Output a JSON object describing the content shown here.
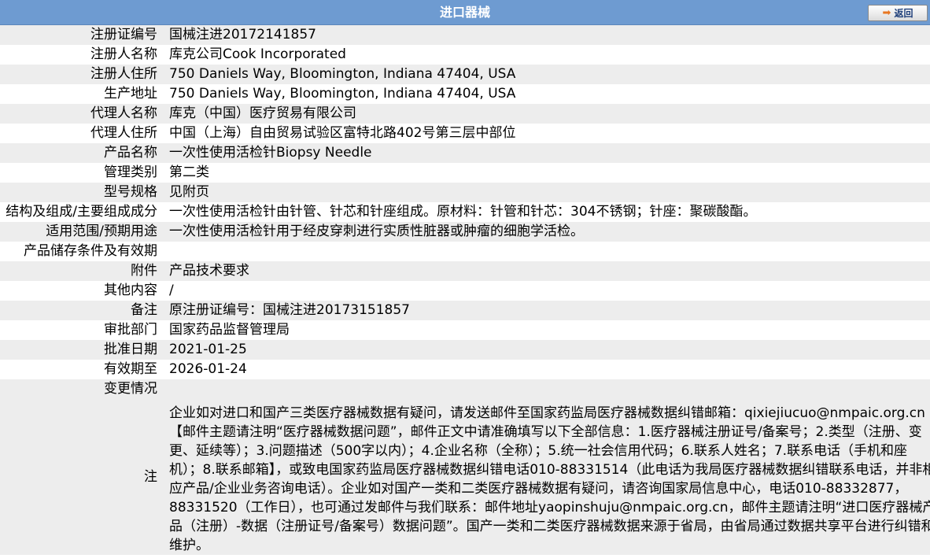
{
  "header": {
    "title": "进口器械",
    "back_label": "返回"
  },
  "rows": [
    {
      "label": "注册证编号",
      "value": "国械注进20172141857"
    },
    {
      "label": "注册人名称",
      "value": "库克公司Cook Incorporated"
    },
    {
      "label": "注册人住所",
      "value": "750 Daniels Way, Bloomington, Indiana 47404, USA"
    },
    {
      "label": "生产地址",
      "value": "750 Daniels Way, Bloomington, Indiana 47404, USA"
    },
    {
      "label": "代理人名称",
      "value": "库克（中国）医疗贸易有限公司"
    },
    {
      "label": "代理人住所",
      "value": "中国（上海）自由贸易试验区富特北路402号第三层中部位"
    },
    {
      "label": "产品名称",
      "value": "一次性使用活检针Biopsy Needle"
    },
    {
      "label": "管理类别",
      "value": "第二类"
    },
    {
      "label": "型号规格",
      "value": "见附页"
    },
    {
      "label": "结构及组成/主要组成成分",
      "value": "一次性使用活检针由针管、针芯和针座组成。原材料：针管和针芯：304不锈钢；针座：聚碳酸酯。"
    },
    {
      "label": "适用范围/预期用途",
      "value": "一次性使用活检针用于经皮穿刺进行实质性脏器或肿瘤的细胞学活检。"
    },
    {
      "label": "产品储存条件及有效期",
      "value": ""
    },
    {
      "label": "附件",
      "value": "产品技术要求"
    },
    {
      "label": "其他内容",
      "value": "/"
    },
    {
      "label": "备注",
      "value": "原注册证编号：国械注进20173151857"
    },
    {
      "label": "审批部门",
      "value": "国家药品监督管理局"
    },
    {
      "label": "批准日期",
      "value": "2021-01-25"
    },
    {
      "label": "有效期至",
      "value": "2026-01-24"
    },
    {
      "label": "变更情况",
      "value": ""
    }
  ],
  "note": {
    "label": "注",
    "text": "企业如对进口和国产三类医疗器械数据有疑问，请发送邮件至国家药监局医疗器械数据纠错邮箱：qixiejiucuo@nmpaic.org.cn【邮件主题请注明“医疗器械数据问题”，邮件正文中请准确填写以下全部信息：1.医疗器械注册证号/备案号；2.类型（注册、变更、延续等）；3.问题描述（500字以内）；4.企业名称（全称）；5.统一社会信用代码；6.联系人姓名；7.联系电话（手机和座机）；8.联系邮箱】，或致电国家药监局医疗器械数据纠错电话010-88331514（此电话为我局医疗器械数据纠错联系电话，并非相应产品/企业业务咨询电话）。企业如对国产一类和二类医疗器械数据有疑问，请咨询国家局信息中心，电话010-88332877，88331520（工作日），也可通过发邮件与我们联系：邮件地址yaopinshuju@nmpaic.org.cn，邮件主题请注明“进口医疗器械产品（注册）-数据（注册证号/备案号）数据问题”。国产一类和二类医疗器械数据来源于省局，由省局通过数据共享平台进行纠错和维护。"
  }
}
